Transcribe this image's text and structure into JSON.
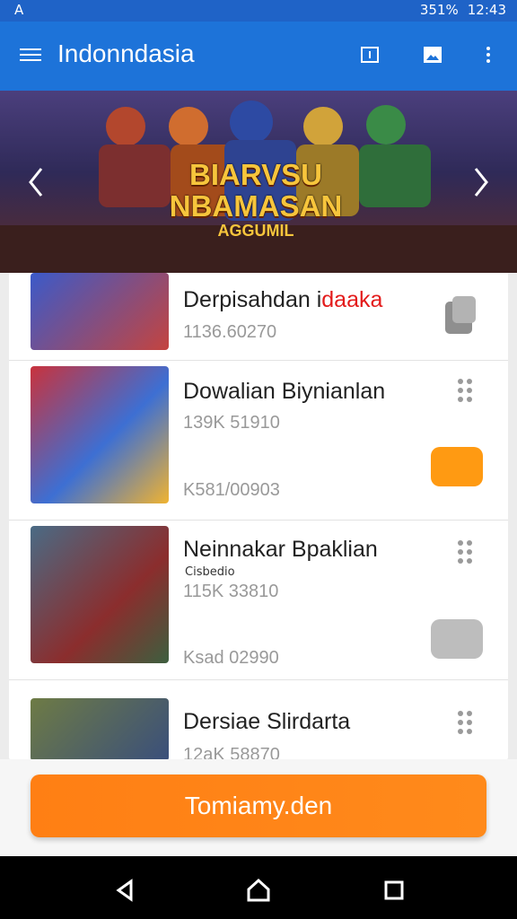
{
  "status": {
    "left": "A",
    "battery": "351%",
    "time": "12:43"
  },
  "app": {
    "title": "Indonndasia"
  },
  "hero": {
    "line1": "BIARVSU",
    "line2": "NBAMASAN",
    "line3": "AGGUMIL"
  },
  "items": [
    {
      "name": "Derpisahdan i",
      "name_accent": "daaka",
      "meta1": "1136.60270",
      "meta2": ""
    },
    {
      "name": "Dowalian Biynianlan",
      "meta1": "139K 51910",
      "meta2": "K581/00903"
    },
    {
      "name": "Neinnakar Bpaklian",
      "sub": "Cisbedio",
      "meta1": "115K 33810",
      "meta2": "Ksad 02990"
    },
    {
      "name": "Dersiae Slirdarta",
      "meta1": "12aK 58870",
      "meta2": ""
    }
  ],
  "cta": {
    "label": "Tomiamy.den"
  }
}
